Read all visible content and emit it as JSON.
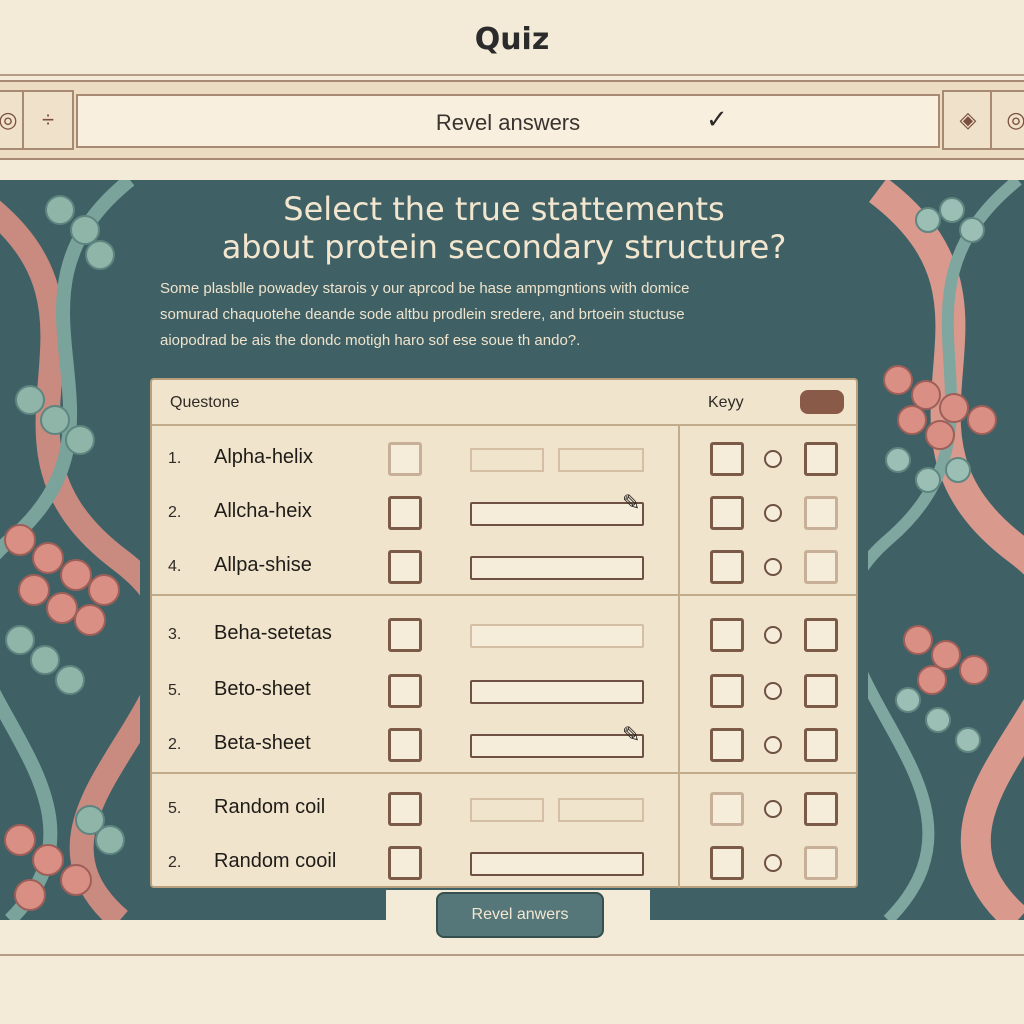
{
  "app": {
    "title": "Quiz"
  },
  "toolbar": {
    "field_label": "Revel answers",
    "check_glyph": "✓",
    "left_icons": [
      "target-icon",
      "divide-icon"
    ],
    "right_icons": [
      "diamond-arrow-icon",
      "target-icon"
    ]
  },
  "heading": {
    "line1": "Select the true  stattements",
    "line2": "about   protein secondary structure?"
  },
  "description": [
    "Some plasblle powadey starois y our aprcod be hase ampmgntions with domice",
    "somurad chaquotehe deande sode altbu prodlein sredere, and brtoein stuctuse",
    "aiopodrad be ais the dondc motigh haro sof ese soue th ando?."
  ],
  "sheet": {
    "header_question": "Questone",
    "header_key": "Keyy",
    "rows": [
      {
        "num": "1.",
        "label": "Alpha-helix"
      },
      {
        "num": "2.",
        "label": "Allcha-heix"
      },
      {
        "num": "4.",
        "label": "Allpa-shise"
      },
      {
        "num": "3.",
        "label": "Beha-setetas"
      },
      {
        "num": "5.",
        "label": "Beto-sheet"
      },
      {
        "num": "2.",
        "label": "Beta-sheet"
      },
      {
        "num": "5.",
        "label": "Random coil"
      },
      {
        "num": "2.",
        "label": "Random cooil"
      }
    ]
  },
  "reveal_button": {
    "label": "Revel anwers"
  },
  "colors": {
    "background": "#f4ead8",
    "panel": "#3f6166",
    "button": "#56777a",
    "checkbox_border": "#7b5a48"
  }
}
